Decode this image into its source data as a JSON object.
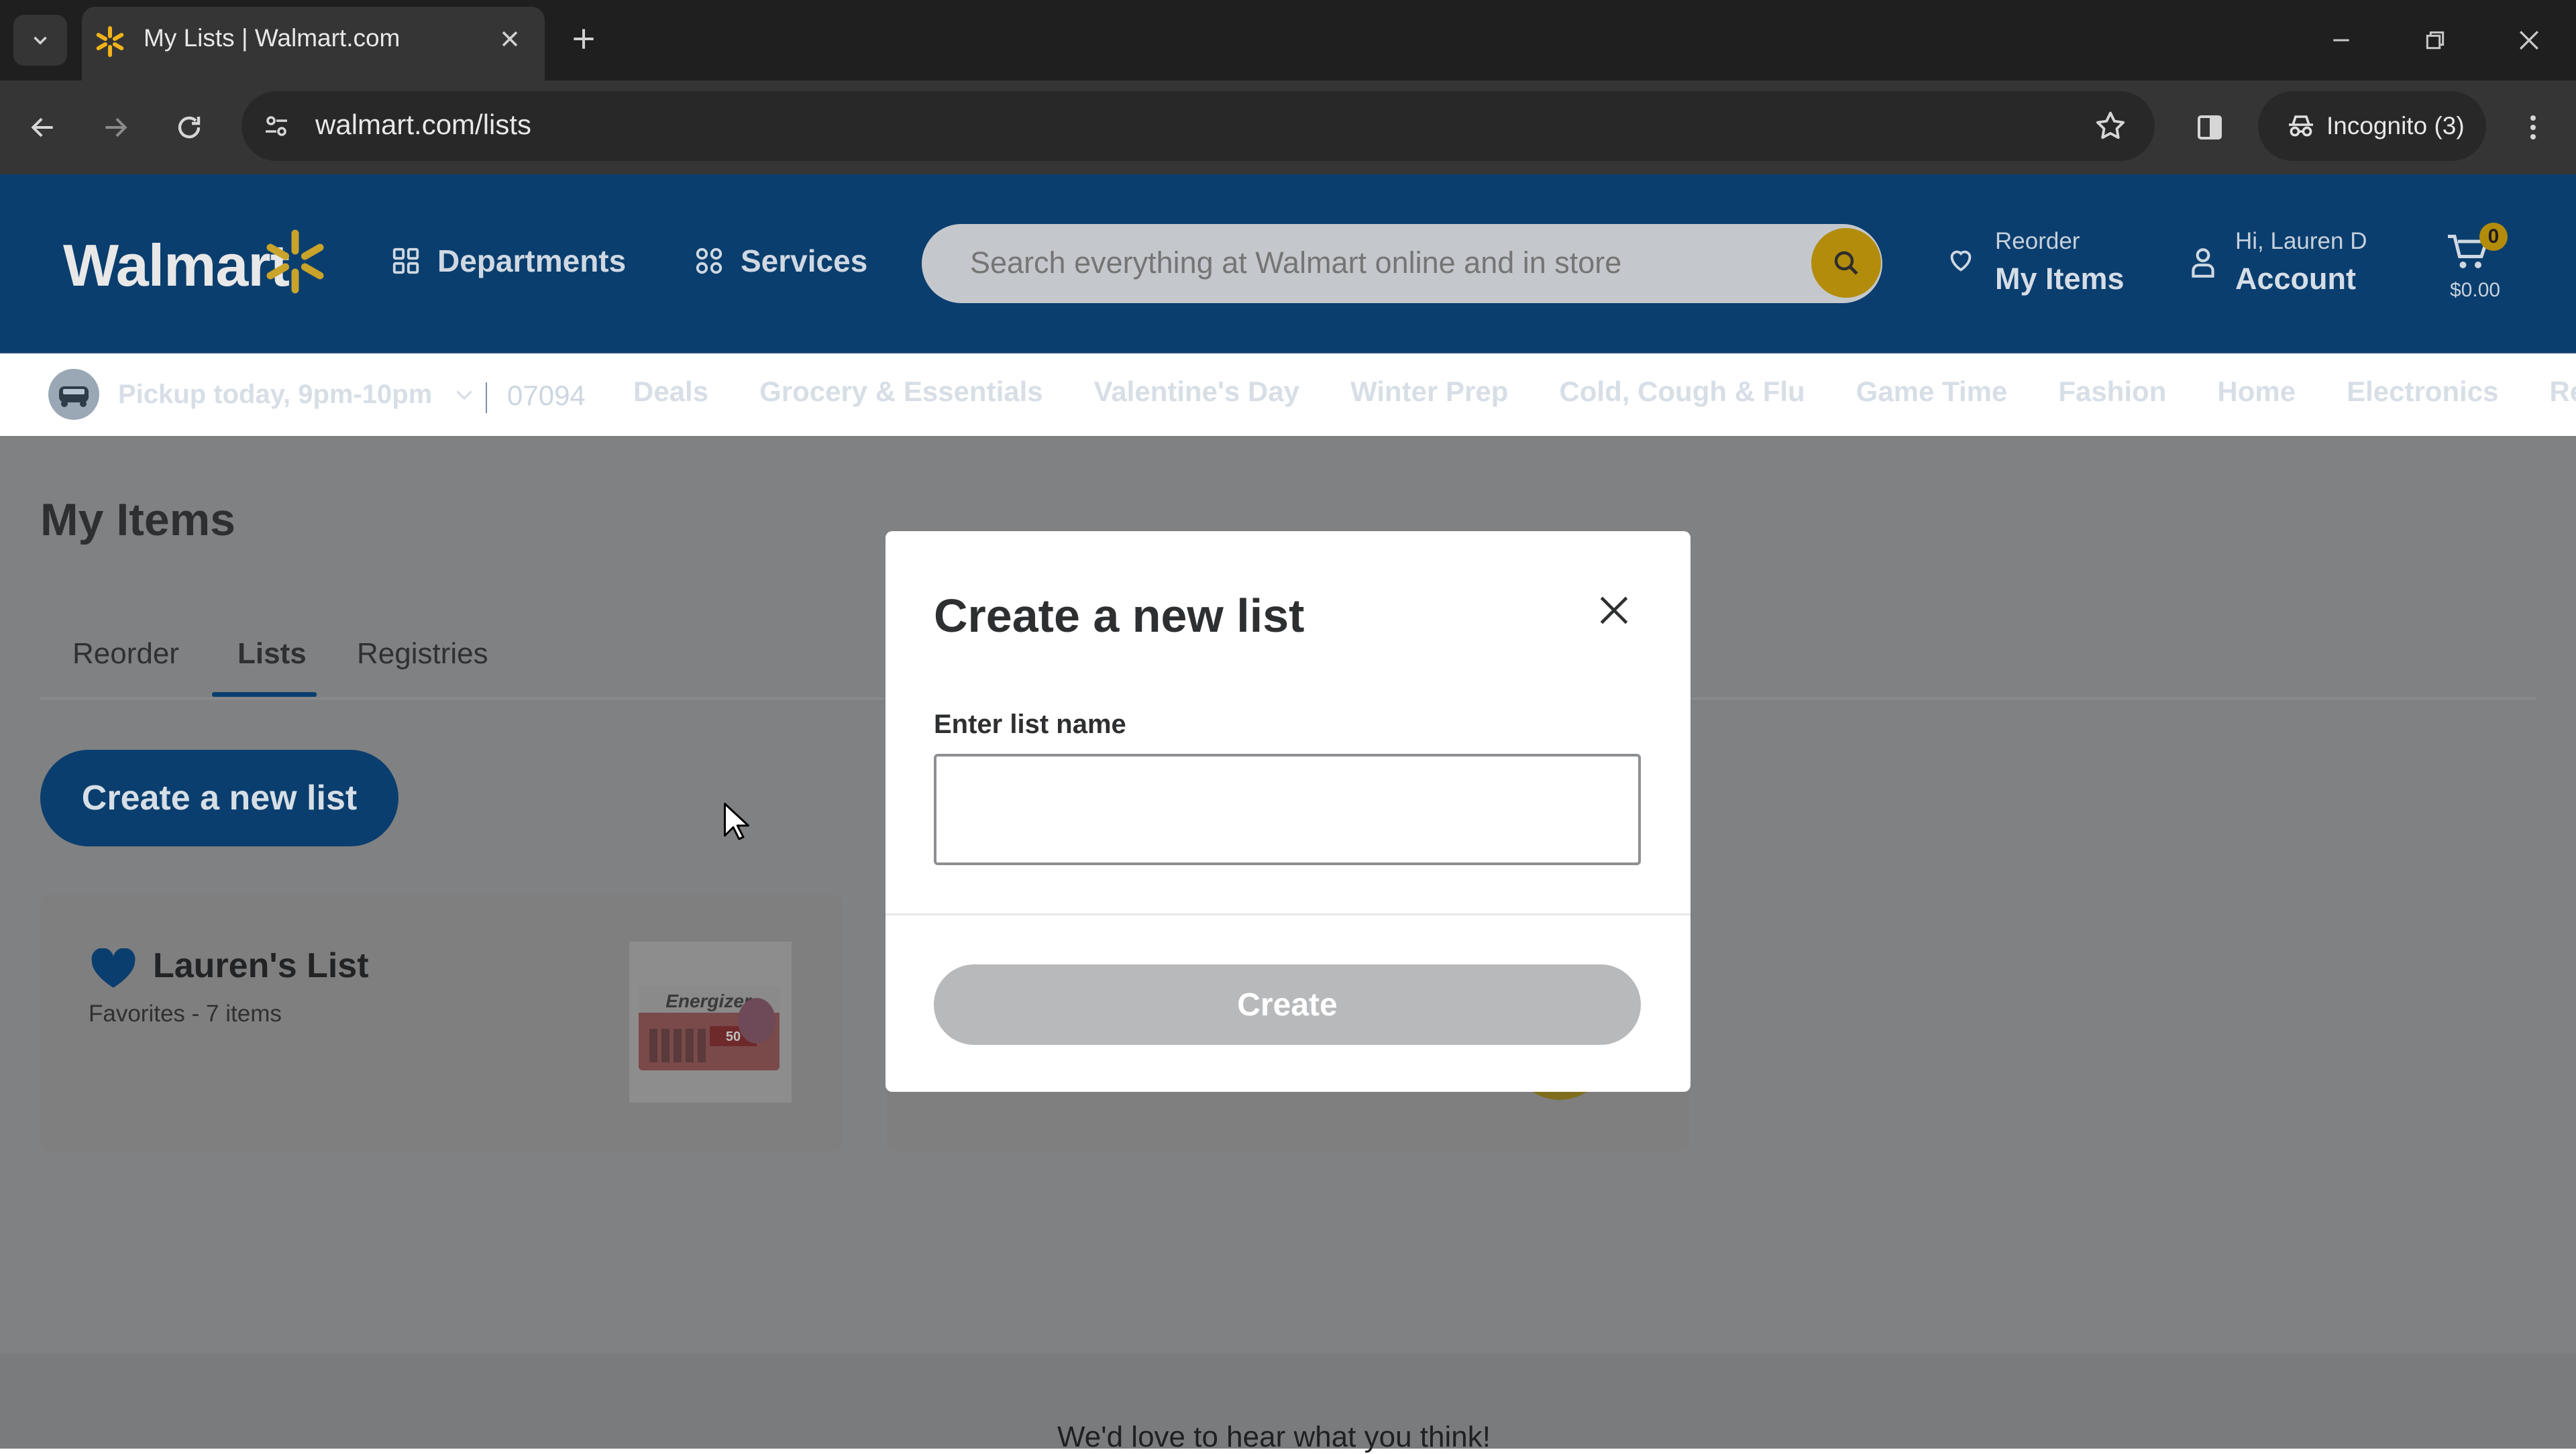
{
  "browser": {
    "tab_title": "My Lists | Walmart.com",
    "url": "walmart.com/lists",
    "incognito_label": "Incognito (3)"
  },
  "header": {
    "logo_text": "Walmart",
    "departments_label": "Departments",
    "services_label": "Services",
    "search_placeholder": "Search everything at Walmart online and in store",
    "reorder_small": "Reorder",
    "reorder_big": "My Items",
    "account_small": "Hi, Lauren D",
    "account_big": "Account",
    "cart_count": "0",
    "cart_total": "$0.00"
  },
  "subnav": {
    "pickup_label": "Pickup today, 9pm-10pm",
    "zip": "07094",
    "links": [
      "Deals",
      "Grocery & Essentials",
      "Valentine's Day",
      "Winter Prep",
      "Cold, Cough & Flu",
      "Game Time",
      "Fashion",
      "Home",
      "Electronics",
      "Registry"
    ]
  },
  "page": {
    "title": "My Items",
    "tabs": [
      "Reorder",
      "Lists",
      "Registries"
    ],
    "active_tab": "Lists",
    "create_button": "Create a new list",
    "lists": [
      {
        "name": "Lauren's List",
        "subtitle": "Favorites - 7 items",
        "thumb_brand": "Energizer",
        "thumb_badge": "50"
      }
    ],
    "feedback_text": "We'd love to hear what you think!"
  },
  "modal": {
    "title": "Create a new list",
    "field_label": "Enter list name",
    "field_value": "",
    "create_label": "Create"
  },
  "colors": {
    "walmart_blue": "#0071dc",
    "walmart_yellow": "#ffc220"
  }
}
